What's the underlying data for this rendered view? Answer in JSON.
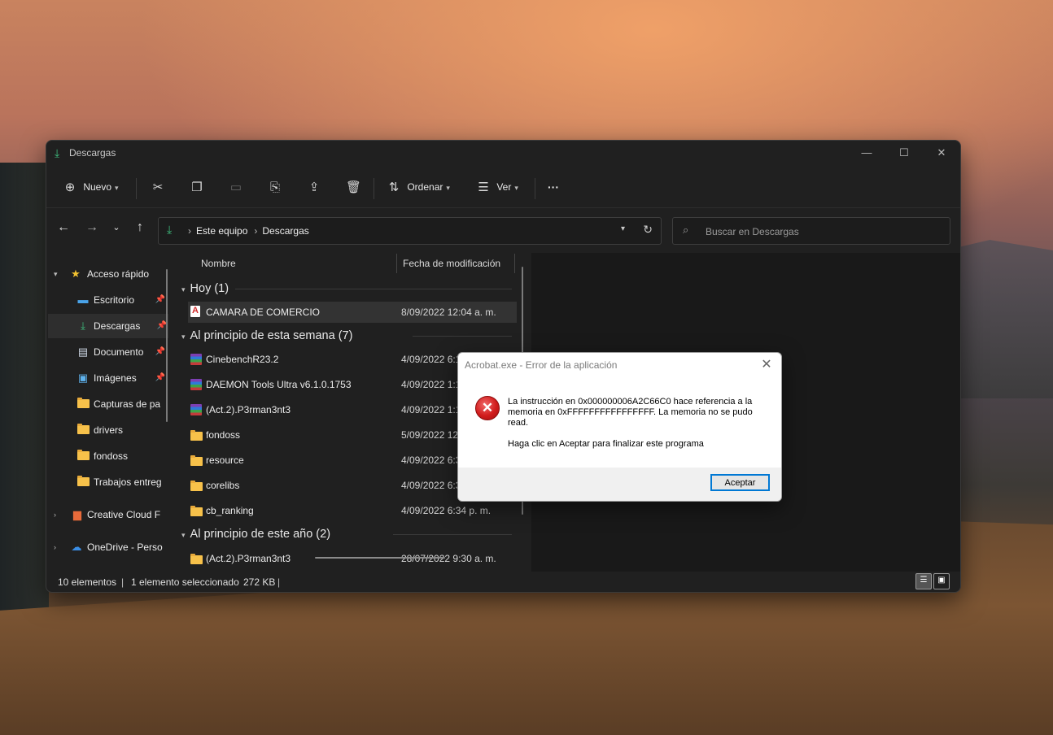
{
  "window": {
    "title": "Descargas",
    "controls": {
      "minimize": "—",
      "maximize": "☐",
      "close": "✕"
    }
  },
  "toolbar": {
    "new_label": "Nuevo",
    "sort_label": "Ordenar",
    "view_label": "Ver",
    "more_label": "···"
  },
  "address": {
    "crumbs": [
      "Este equipo",
      "Descargas"
    ],
    "search_placeholder": "Buscar en Descargas"
  },
  "sidebar": {
    "items": [
      {
        "label": "Acceso rápido",
        "pinned": false
      },
      {
        "label": "Escritorio",
        "pinned": true
      },
      {
        "label": "Descargas",
        "pinned": true,
        "selected": true
      },
      {
        "label": "Documento",
        "pinned": true
      },
      {
        "label": "Imágenes",
        "pinned": true
      },
      {
        "label": "Capturas de pa",
        "pinned": false
      },
      {
        "label": "drivers",
        "pinned": false
      },
      {
        "label": "fondoss",
        "pinned": false
      },
      {
        "label": "Trabajos entreg",
        "pinned": false
      },
      {
        "label": "Creative Cloud F",
        "pinned": false
      },
      {
        "label": "OneDrive - Perso",
        "pinned": false
      }
    ]
  },
  "columns": {
    "name": "Nombre",
    "date": "Fecha de modificación"
  },
  "groups": [
    {
      "label": "Hoy (1)",
      "files": [
        {
          "name": "CAMARA DE COMERCIO",
          "date": "8/09/2022 12:04 a. m.",
          "type": "pdf",
          "selected": true
        }
      ]
    },
    {
      "label": "Al principio de esta semana (7)",
      "files": [
        {
          "name": "CinebenchR23.2",
          "date": "4/09/2022 6:1",
          "type": "archive"
        },
        {
          "name": "DAEMON Tools Ultra v6.1.0.1753",
          "date": "4/09/2022 1:1",
          "type": "archive"
        },
        {
          "name": "(Act.2).P3rman3nt3",
          "date": "4/09/2022 1:1",
          "type": "archive"
        },
        {
          "name": "fondoss",
          "date": "5/09/2022 12",
          "type": "folder"
        },
        {
          "name": "resource",
          "date": "4/09/2022 6:3",
          "type": "folder"
        },
        {
          "name": "corelibs",
          "date": "4/09/2022 6:3",
          "type": "folder"
        },
        {
          "name": "cb_ranking",
          "date": "4/09/2022 6:34 p. m.",
          "type": "folder"
        }
      ]
    },
    {
      "label": "Al principio de este año (2)",
      "files": [
        {
          "name": "(Act.2).P3rman3nt3",
          "date": "28/07/2022 9:30 a. m.",
          "type": "folder"
        }
      ]
    }
  ],
  "status": {
    "count": "10 elementos",
    "selection": "1 elemento seleccionado",
    "size": "272 KB"
  },
  "dialog": {
    "title": "Acrobat.exe - Error de la aplicación",
    "message": "La instrucción en 0x000000006A2C66C0 hace referencia a la memoria en 0xFFFFFFFFFFFFFFFF. La memoria no se pudo read.",
    "message2": "Haga clic en Aceptar para finalizar este programa",
    "button": "Aceptar",
    "icon": "error-x"
  },
  "colors": {
    "accent": "#0078d4",
    "download_green": "#3fbf7f",
    "error_red": "#d11c1c"
  }
}
